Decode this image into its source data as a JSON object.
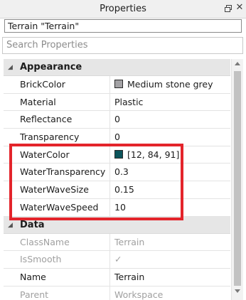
{
  "window": {
    "title": "Properties"
  },
  "selection_label": "Terrain \"Terrain\"",
  "search": {
    "placeholder": "Search Properties"
  },
  "categories": [
    {
      "label": "Appearance",
      "rows": [
        {
          "name": "BrickColor",
          "value": "Medium stone grey",
          "swatch": "#a3a2a5"
        },
        {
          "name": "Material",
          "value": "Plastic"
        },
        {
          "name": "Reflectance",
          "value": "0"
        },
        {
          "name": "Transparency",
          "value": "0"
        },
        {
          "name": "WaterColor",
          "value": "[12, 84, 91]",
          "swatch": "#0c545b"
        },
        {
          "name": "WaterTransparency",
          "value": "0.3"
        },
        {
          "name": "WaterWaveSize",
          "value": "0.15"
        },
        {
          "name": "WaterWaveSpeed",
          "value": "10"
        }
      ]
    },
    {
      "label": "Data",
      "rows": [
        {
          "name": "ClassName",
          "value": "Terrain",
          "disabled": true
        },
        {
          "name": "IsSmooth",
          "value": "✓",
          "disabled": true
        },
        {
          "name": "Name",
          "value": "Terrain"
        },
        {
          "name": "Parent",
          "value": "Workspace",
          "disabled": true
        }
      ]
    }
  ],
  "highlight_color": "#e3242b"
}
